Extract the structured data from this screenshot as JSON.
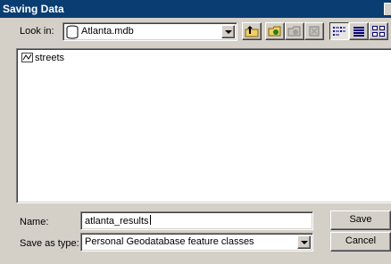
{
  "window": {
    "title": "Saving Data"
  },
  "look_in": {
    "label": "Look in:",
    "value": "Atlanta.mdb",
    "icon": "database-icon"
  },
  "toolbar": {
    "up_icon": "up-one-level-icon",
    "connect_icon": "connect-to-folder-icon",
    "disconnect_icon": "disconnect-folder-icon",
    "delete_icon": "delete-icon",
    "list_view_icon": "list-view-icon",
    "details_view_icon": "details-view-icon",
    "thumbnails_view_icon": "thumbnails-view-icon"
  },
  "file_list": {
    "items": [
      {
        "name": "streets",
        "icon": "line-feature-class-icon"
      }
    ]
  },
  "name_field": {
    "label": "Name:",
    "value": "atlanta_results"
  },
  "save_type": {
    "label": "Save as type:",
    "value": "Personal Geodatabase feature classes"
  },
  "buttons": {
    "save": "Save",
    "cancel": "Cancel"
  },
  "colors": {
    "titlebar": "#0a3d72",
    "dialog_bg": "#d4d0c8"
  }
}
